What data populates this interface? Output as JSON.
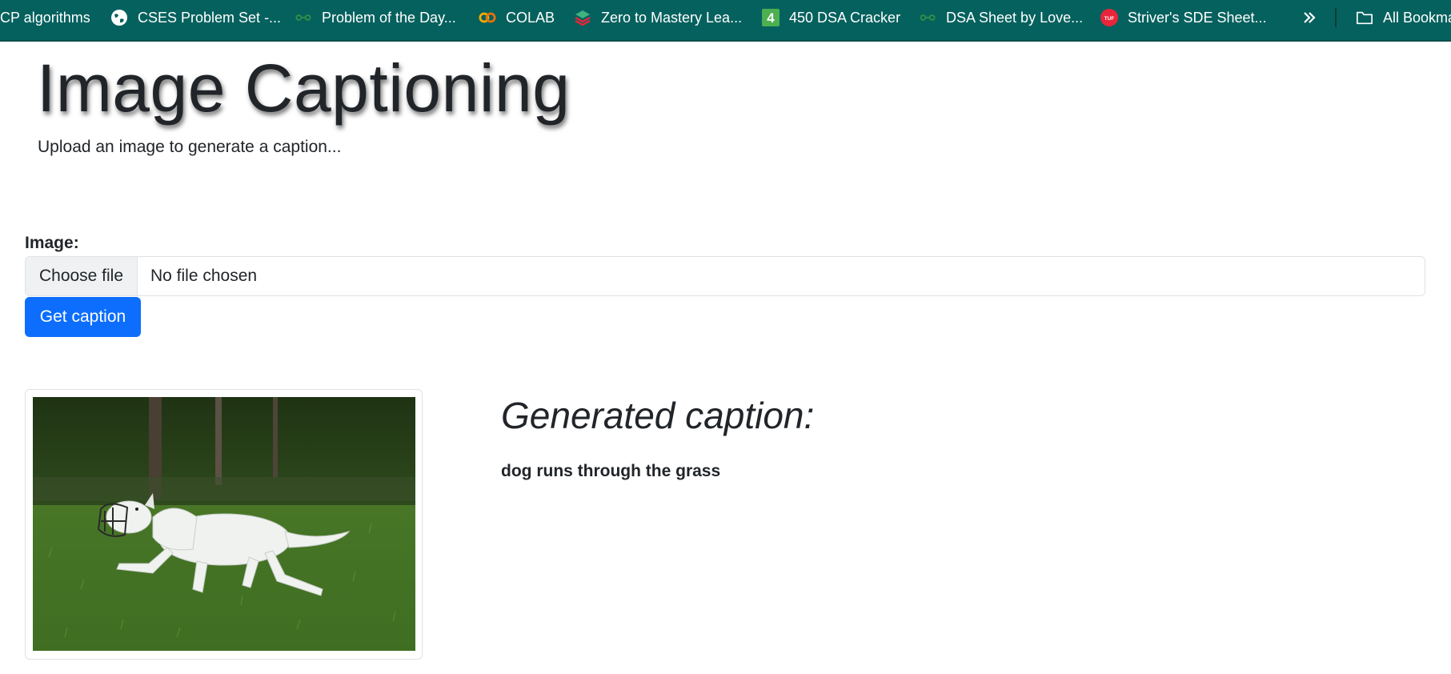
{
  "bookmarks": [
    {
      "label": "CP algorithms",
      "icon": "none"
    },
    {
      "label": "CSES Problem Set -...",
      "icon": "globe-icon"
    },
    {
      "label": "Problem of the Day...",
      "icon": "gfg-icon"
    },
    {
      "label": "COLAB",
      "icon": "colab-icon"
    },
    {
      "label": "Zero to Mastery Lea...",
      "icon": "ztm-icon"
    },
    {
      "label": "450 DSA Cracker",
      "icon": "number-4-icon"
    },
    {
      "label": "DSA Sheet by Love...",
      "icon": "gfg-icon"
    },
    {
      "label": "Striver's SDE Sheet...",
      "icon": "tuf-icon"
    },
    {
      "label": "All Bookmarks",
      "icon": "folder-icon"
    }
  ],
  "colors": {
    "toolbar": "#05615e",
    "primary": "#0d6efd",
    "gfg_green": "#2f8d46",
    "colab_orange": "#f9ab00",
    "tuf_red": "#e8253a"
  },
  "page": {
    "title": "Image Captioning",
    "subtitle": "Upload an image to generate a caption..."
  },
  "form": {
    "image_label": "Image:",
    "choose_file": "Choose file",
    "file_status": "No file chosen",
    "submit": "Get caption"
  },
  "result": {
    "heading": "Generated caption:",
    "caption": "dog runs through the grass",
    "image_alt": "white dog wearing a muzzle running through grass"
  }
}
